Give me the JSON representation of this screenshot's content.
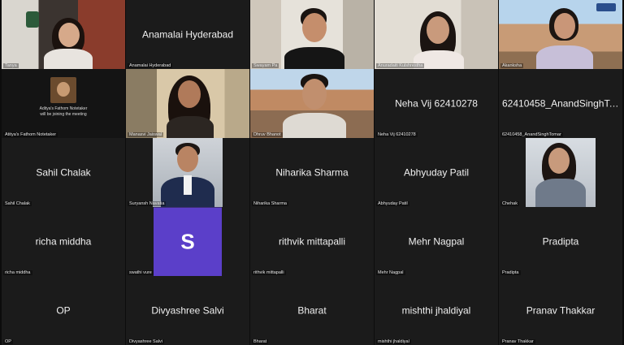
{
  "tiles": [
    {
      "name": "Tanya",
      "type": "video"
    },
    {
      "name": "Anamalai Hyderabad",
      "center": "Anamalai Hyderabad",
      "type": "text"
    },
    {
      "name": "Swayam Pa",
      "type": "video"
    },
    {
      "name": "Anuradaiti Kulshrestha",
      "type": "video"
    },
    {
      "name": "Akanksha",
      "type": "video"
    },
    {
      "name": "Atitya's Fathom Notetaker",
      "type": "note",
      "note_line1": "Aditya's Fathom Notetaker",
      "note_line2": "will be joining the meeting"
    },
    {
      "name": "Manasvi Jaiswal",
      "type": "video"
    },
    {
      "name": "Dhruv Bhanot",
      "type": "video"
    },
    {
      "name": "Neha Vij 62410278",
      "center": "Neha Vij 62410278",
      "type": "text"
    },
    {
      "name": "62410458_AnandSinghTomar",
      "center": "62410458_AnandSinghTomar",
      "type": "text"
    },
    {
      "name": "Sahil Chalak",
      "center": "Sahil Chalak",
      "type": "text"
    },
    {
      "name": "Suryansh Navatia",
      "type": "photo"
    },
    {
      "name": "Niharika Sharma",
      "center": "Niharika Sharma",
      "type": "text"
    },
    {
      "name": "Abhyuday Patil",
      "center": "Abhyuday Patil",
      "type": "text"
    },
    {
      "name": "Chehak",
      "type": "photo"
    },
    {
      "name": "richa middha",
      "center": "richa middha",
      "type": "text"
    },
    {
      "name": "swathi vure",
      "type": "avatar",
      "avatar_letter": "S",
      "avatar_color": "#5b3fc9"
    },
    {
      "name": "rithvik mittapalli",
      "center": "rithvik mittapalli",
      "type": "text"
    },
    {
      "name": "Mehr Nagpal",
      "center": "Mehr Nagpal",
      "type": "text"
    },
    {
      "name": "Pradipta",
      "center": "Pradipta",
      "type": "text"
    },
    {
      "name": "OP",
      "center": "OP",
      "type": "text"
    },
    {
      "name": "Divyashree Salvi",
      "center": "Divyashree Salvi",
      "type": "text"
    },
    {
      "name": "Bharat",
      "center": "Bharat",
      "type": "text"
    },
    {
      "name": "mishthi jhaldiyal",
      "center": "mishthi jhaldiyal",
      "type": "text"
    },
    {
      "name": "Pranav Thakkar",
      "center": "Pranav Thakkar",
      "type": "text"
    }
  ]
}
